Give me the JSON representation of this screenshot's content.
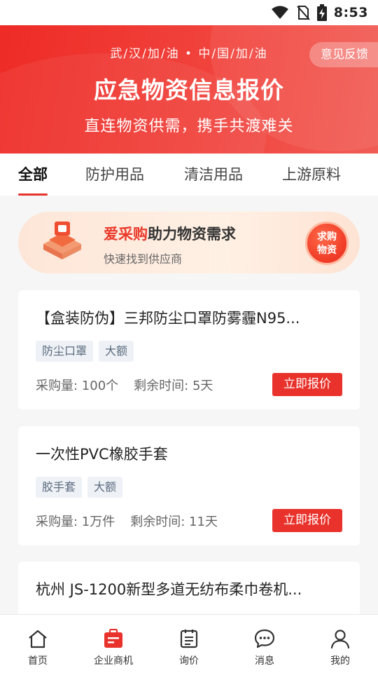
{
  "status_bar": {
    "time": "8:53",
    "icons": [
      "wifi-icon",
      "no-sim-icon",
      "battery-charging-icon"
    ]
  },
  "header": {
    "slogan": "武/汉/加/油 • 中/国/加/油",
    "title": "应急物资信息报价",
    "subtitle": "直连物资供需，携手共渡难关",
    "feedback_label": "意见反馈"
  },
  "tabs": [
    {
      "label": "全部",
      "active": true
    },
    {
      "label": "防护用品",
      "active": false
    },
    {
      "label": "清洁用品",
      "active": false
    },
    {
      "label": "上游原料",
      "active": false
    }
  ],
  "promo": {
    "title_accent": "爱采购",
    "title_rest": "助力物资需求",
    "subtitle": "快速找到供应商",
    "cta_line1": "求购",
    "cta_line2": "物资"
  },
  "listings": [
    {
      "title": "【盒装防伪】三邦防尘口罩防雾霾N95...",
      "tags": [
        "防尘口罩",
        "大额"
      ],
      "quantity": "采购量: 100个",
      "remaining": "剩余时间: 5天",
      "action_label": "立即报价"
    },
    {
      "title": "一次性PVC橡胶手套",
      "tags": [
        "胶手套",
        "大额"
      ],
      "quantity": "采购量: 1万件",
      "remaining": "剩余时间: 11天",
      "action_label": "立即报价"
    },
    {
      "title": "杭州 JS-1200新型多道无纺布柔巾卷机..."
    }
  ],
  "bottom_nav": [
    {
      "label": "首页",
      "icon": "home-icon",
      "active": false
    },
    {
      "label": "企业商机",
      "icon": "business-icon",
      "active": true
    },
    {
      "label": "询价",
      "icon": "inquiry-icon",
      "active": false
    },
    {
      "label": "消息",
      "icon": "message-icon",
      "active": false
    },
    {
      "label": "我的",
      "icon": "profile-icon",
      "active": false
    }
  ],
  "colors": {
    "brand_red": "#e8322b",
    "tag_bg": "#eef1f5",
    "tag_text": "#5b6b7f"
  }
}
